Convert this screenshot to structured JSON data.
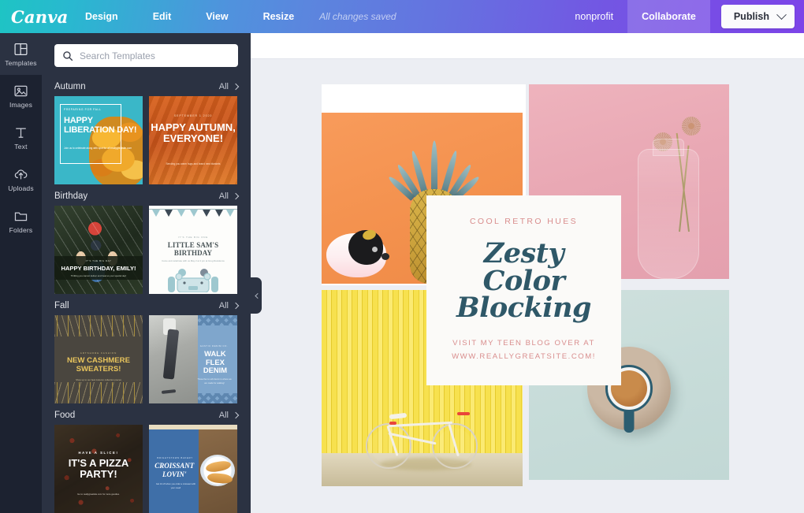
{
  "header": {
    "brand": "Canva",
    "menu": [
      {
        "label": "Design"
      },
      {
        "label": "Edit"
      },
      {
        "label": "View"
      },
      {
        "label": "Resize"
      }
    ],
    "save_status": "All changes saved",
    "account": "nonprofit",
    "collaborate_label": "Collaborate",
    "publish_label": "Publish",
    "accent_gradient_start": "#1ec4c4",
    "accent_gradient_end": "#7c44e8"
  },
  "rail": {
    "items": [
      {
        "label": "Templates",
        "icon": "templates-icon",
        "active": true
      },
      {
        "label": "Images",
        "icon": "images-icon",
        "active": false
      },
      {
        "label": "Text",
        "icon": "text-icon",
        "active": false
      },
      {
        "label": "Uploads",
        "icon": "uploads-icon",
        "active": false
      },
      {
        "label": "Folders",
        "icon": "folders-icon",
        "active": false
      }
    ]
  },
  "panel": {
    "background": "#2b3242",
    "search": {
      "placeholder": "Search Templates",
      "value": "",
      "icon": "search-icon"
    },
    "all_label": "All",
    "sections": [
      {
        "title": "Autumn",
        "templates": [
          {
            "name": "happy-liberation-day",
            "kicker": "PREPARING FOR FALL",
            "headline": "HAPPY LIBERATION DAY!",
            "subtext": "Join us to celebrate along with spot for all reallygreatsite.com"
          },
          {
            "name": "happy-autumn-everyone",
            "kicker": "SEPTEMBER 1 2020",
            "headline": "HAPPY AUTUMN, EVERYONE!",
            "subtext": "Sending you warm hugs and brand new blankets"
          }
        ]
      },
      {
        "title": "Birthday",
        "templates": [
          {
            "name": "happy-birthday-emily",
            "kicker": "IT'S THE BIG DAY",
            "headline": "HAPPY BIRTHDAY, EMILY!",
            "subtext": "Thrilling you cannot deliver and treat us your special day!"
          },
          {
            "name": "little-sams-birthday",
            "kicker": "IT'S THE BIG ONE",
            "headline": "LITTLE SAM'S BIRTHDAY",
            "subtext": "Come and celebrate with us May 2 at 2 pm at Greg Residence"
          }
        ]
      },
      {
        "title": "Fall",
        "templates": [
          {
            "name": "new-cashmere-sweaters",
            "kicker": "ARTSHORE FASHION",
            "headline": "NEW CASHMERE SWEATERS!",
            "subtext": "Shop up to our best Autumn collection pieces"
          },
          {
            "name": "walk-flex-denim",
            "kicker": "GASTIC DENIM CO.",
            "headline": "WALK FLEX DENIM",
            "subtext": "Those flex to soft denim is where we are made for walking!"
          }
        ]
      },
      {
        "title": "Food",
        "templates": [
          {
            "name": "its-a-pizza-party",
            "kicker": "HAVE A SLICE!",
            "headline": "IT'S A PIZZA PARTY!",
            "subtext": "Go to reallygreatsite.com for more goodies."
          },
          {
            "name": "croissant-lovin",
            "kicker": "BRIGHTSTOWN BAKERY",
            "headline": "CROISSANT LOVIN'",
            "subtext": "Get 10 off when you order a croissant with your meal!"
          }
        ]
      }
    ],
    "collapse_icon": "chevron-left-icon"
  },
  "canvas": {
    "background": "#eceef3",
    "design": {
      "name": "zesty-color-blocking",
      "card": {
        "kicker": "COOL RETRO HUES",
        "title_line1": "Zesty Color",
        "title_line2": "Blocking",
        "footer_line1": "VISIT MY TEEN BLOG OVER AT",
        "footer_line2": "WWW.REALLYGREATSITE.COM!",
        "kicker_color": "#d98e8e",
        "title_color": "#2f5868"
      },
      "cells": [
        {
          "name": "photo-pineapple-guinea-pig",
          "color": "#f5935a"
        },
        {
          "name": "photo-pink-vase-flowers",
          "color": "#e9a8b4"
        },
        {
          "name": "photo-yellow-fence-bicycle",
          "color": "#f7e14e"
        },
        {
          "name": "photo-mint-coffee-cup",
          "color": "#c7dcd9"
        }
      ]
    }
  }
}
